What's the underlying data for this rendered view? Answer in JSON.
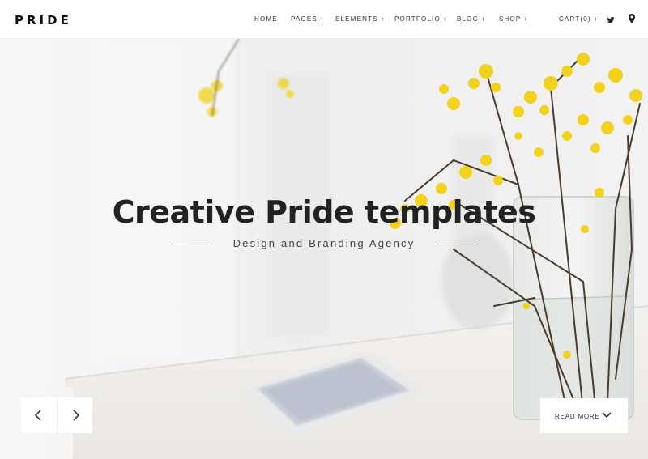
{
  "logo": "PRIDE",
  "nav": {
    "items": [
      {
        "label": "HOME",
        "plus": ""
      },
      {
        "label": "PAGES",
        "plus": "+"
      },
      {
        "label": "ELEMENTS",
        "plus": "+"
      },
      {
        "label": "PORTFOLIO",
        "plus": "+"
      },
      {
        "label": "BLOG",
        "plus": "+"
      },
      {
        "label": "SHOP",
        "plus": "+"
      },
      {
        "label": "CART(0)",
        "plus": "+"
      }
    ],
    "icons": [
      "twitter-icon",
      "map-pin-icon"
    ]
  },
  "hero": {
    "title": "Creative Pride templates",
    "subtitle": "Design and Branding Agency",
    "read_more_label": "READ MORE",
    "colors": {
      "accent_line": "#3d3d4a",
      "flower_yellow": "#f2d21c",
      "stem": "#4a3b2a"
    }
  },
  "slider": {
    "prev_icon": "chevron-left-icon",
    "next_icon": "chevron-right-icon",
    "read_more_icon": "chevron-down-icon"
  }
}
